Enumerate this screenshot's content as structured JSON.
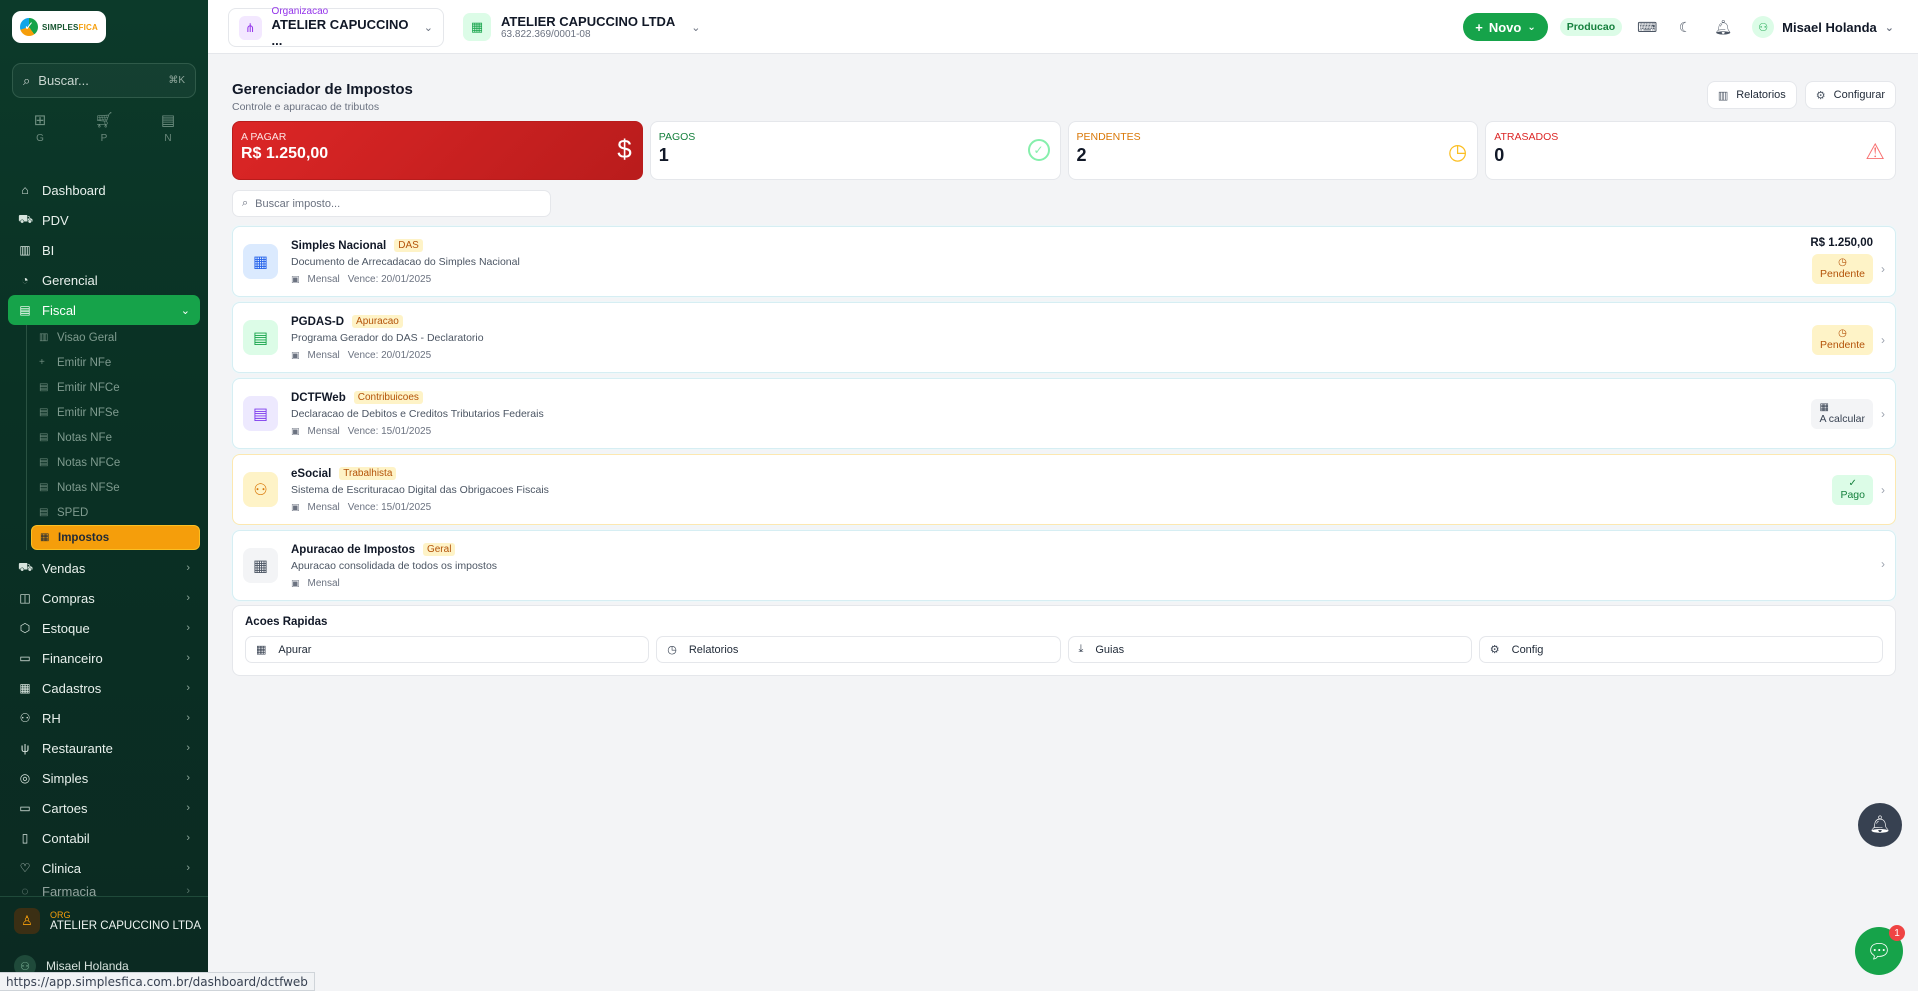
{
  "sidebar": {
    "logo_text": "SIMPLESFICA",
    "search_placeholder": "Buscar...",
    "search_shortcut": "⌘K",
    "quick": [
      {
        "label": "G",
        "icon": "grid-icon"
      },
      {
        "label": "P",
        "icon": "cart-icon"
      },
      {
        "label": "N",
        "icon": "document-icon"
      }
    ],
    "items_top": [
      {
        "label": "Dashboard",
        "icon": "home-icon"
      },
      {
        "label": "PDV",
        "icon": "cart-icon"
      },
      {
        "label": "BI",
        "icon": "bar-chart-icon"
      },
      {
        "label": "Gerencial",
        "icon": "gauge-icon"
      }
    ],
    "fiscal": {
      "label": "Fiscal",
      "icon": "document-icon"
    },
    "fiscal_sub": [
      {
        "label": "Visao Geral",
        "icon": "chart-icon"
      },
      {
        "label": "Emitir NFe",
        "icon": "plus-icon"
      },
      {
        "label": "Emitir NFCe",
        "icon": "document-icon"
      },
      {
        "label": "Emitir NFSe",
        "icon": "document-icon"
      },
      {
        "label": "Notas NFe",
        "icon": "document-icon"
      },
      {
        "label": "Notas NFCe",
        "icon": "document-icon"
      },
      {
        "label": "Notas NFSe",
        "icon": "document-icon"
      },
      {
        "label": "SPED",
        "icon": "document-icon"
      },
      {
        "label": "Impostos",
        "icon": "calculator-icon"
      }
    ],
    "items_bottom": [
      {
        "label": "Vendas",
        "icon": "cart-icon"
      },
      {
        "label": "Compras",
        "icon": "bag-icon"
      },
      {
        "label": "Estoque",
        "icon": "box-icon"
      },
      {
        "label": "Financeiro",
        "icon": "wallet-icon"
      },
      {
        "label": "Cadastros",
        "icon": "building-icon"
      },
      {
        "label": "RH",
        "icon": "users-icon"
      },
      {
        "label": "Restaurante",
        "icon": "utensils-icon"
      },
      {
        "label": "Simples",
        "icon": "circle-icon"
      },
      {
        "label": "Cartoes",
        "icon": "card-icon"
      },
      {
        "label": "Contabil",
        "icon": "book-icon"
      },
      {
        "label": "Clinica",
        "icon": "heart-icon"
      },
      {
        "label": "Farmacia",
        "icon": "pill-icon"
      }
    ],
    "org_label": "ORG",
    "org_name": "ATELIER CAPUCCINO LTDA",
    "user_name": "Misael Holanda"
  },
  "topbar": {
    "org_label": "Organizacao",
    "org_value": "ATELIER CAPUCCINO ...",
    "company_name": "ATELIER CAPUCCINO LTDA",
    "company_cnpj": "63.822.369/0001-08",
    "new_button": "Novo",
    "env_badge": "Producao",
    "user_name": "Misael Holanda"
  },
  "page": {
    "title": "Gerenciador de Impostos",
    "subtitle": "Controle e apuracao de tributos",
    "reports_button": "Relatorios",
    "config_button": "Configurar"
  },
  "stats": {
    "to_pay": {
      "label": "A PAGAR",
      "value": "R$ 1.250,00"
    },
    "paid": {
      "label": "PAGOS",
      "value": "1"
    },
    "pending": {
      "label": "PENDENTES",
      "value": "2"
    },
    "late": {
      "label": "ATRASADOS",
      "value": "0"
    }
  },
  "tax_search_placeholder": "Buscar imposto...",
  "taxes": [
    {
      "title": "Simples Nacional",
      "tag": "DAS",
      "desc": "Documento de Arrecadacao do Simples Nacional",
      "period": "Mensal",
      "due": "Vence: 20/01/2025",
      "amount": "R$ 1.250,00",
      "status": "Pendente"
    },
    {
      "title": "PGDAS-D",
      "tag": "Apuracao",
      "desc": "Programa Gerador do DAS - Declaratorio",
      "period": "Mensal",
      "due": "Vence: 20/01/2025",
      "amount": "",
      "status": "Pendente"
    },
    {
      "title": "DCTFWeb",
      "tag": "Contribuicoes",
      "desc": "Declaracao de Debitos e Creditos Tributarios Federais",
      "period": "Mensal",
      "due": "Vence: 15/01/2025",
      "amount": "",
      "status": "A calcular"
    },
    {
      "title": "eSocial",
      "tag": "Trabalhista",
      "desc": "Sistema de Escrituracao Digital das Obrigacoes Fiscais",
      "period": "Mensal",
      "due": "Vence: 15/01/2025",
      "amount": "",
      "status": "Pago"
    },
    {
      "title": "Apuracao de Impostos",
      "tag": "Geral",
      "desc": "Apuracao consolidada de todos os impostos",
      "period": "Mensal",
      "due": "",
      "amount": "",
      "status": ""
    }
  ],
  "quick_actions": {
    "title": "Acoes Rapidas",
    "buttons": [
      "Apurar",
      "Relatorios",
      "Guias",
      "Config"
    ]
  },
  "status_url": "https://app.simplesfica.com.br/dashboard/dctfweb",
  "chat_badge": "1",
  "colors": {
    "brand": "#16a34a",
    "sidebar_bg": "#0c3a2a",
    "accent": "#f59e0b",
    "danger": "#dc2626"
  }
}
